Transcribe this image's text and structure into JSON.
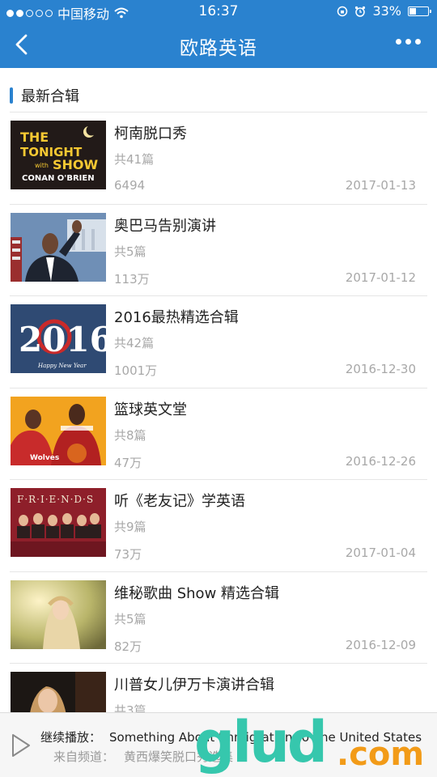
{
  "status_bar": {
    "carrier": "中国移动",
    "time": "16:37",
    "battery": "33%",
    "battery_level": 0.33
  },
  "nav": {
    "title": "欧路英语",
    "back_icon": "chevron-left-icon",
    "more_icon": "more-dots-icon"
  },
  "section": {
    "title": "最新合辑"
  },
  "items": [
    {
      "name": "柯南脱口秀",
      "count": "共41篇",
      "views": "6494",
      "date": "2017-01-13",
      "thumb_text": [
        "THE",
        "TONIGHT",
        "with",
        "SHOW",
        "CONAN O'BRIEN"
      ]
    },
    {
      "name": "奥巴马告别演讲",
      "count": "共5篇",
      "views": "113万",
      "date": "2017-01-12"
    },
    {
      "name": "2016最热精选合辑",
      "count": "共42篇",
      "views": "1001万",
      "date": "2016-12-30",
      "thumb_text": [
        "2016",
        "Happy New Year"
      ]
    },
    {
      "name": "篮球英文堂",
      "count": "共8篇",
      "views": "47万",
      "date": "2016-12-26"
    },
    {
      "name": "听《老友记》学英语",
      "count": "共9篇",
      "views": "73万",
      "date": "2017-01-04",
      "thumb_text": [
        "F·R·I·E·N·D·S"
      ]
    },
    {
      "name": "维秘歌曲 Show 精选合辑",
      "count": "共5篇",
      "views": "82万",
      "date": "2016-12-09"
    },
    {
      "name": "川普女儿伊万卡演讲合辑",
      "count": "共3篇",
      "views": "",
      "date": ""
    }
  ],
  "player": {
    "continue_label": "继续播放：",
    "track": "Something About Immigration To The United States",
    "from_label": "来自频道：",
    "channel": "黄西爆笑脱口秀选集",
    "play_icon": "play-icon"
  },
  "watermark": {
    "main": "glud",
    "suffix": ".com"
  }
}
